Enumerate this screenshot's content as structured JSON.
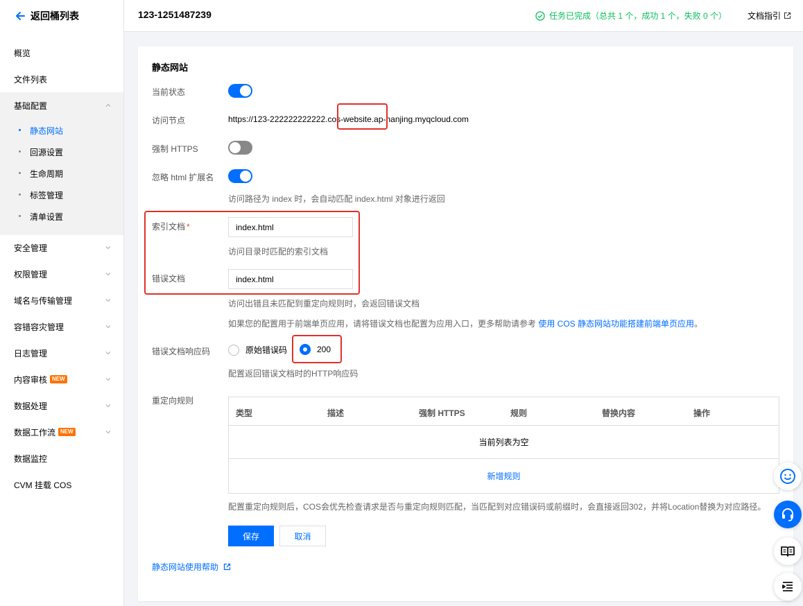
{
  "sidebar": {
    "back_label": "返回桶列表",
    "items": [
      {
        "label": "概览"
      },
      {
        "label": "文件列表"
      },
      {
        "label": "基础配置"
      },
      {
        "label": "安全管理"
      },
      {
        "label": "权限管理"
      },
      {
        "label": "域名与传输管理"
      },
      {
        "label": "容错容灾管理"
      },
      {
        "label": "日志管理"
      },
      {
        "label": "内容审核",
        "badge": "NEW"
      },
      {
        "label": "数据处理"
      },
      {
        "label": "数据工作流",
        "badge": "NEW"
      },
      {
        "label": "数据监控"
      },
      {
        "label": "CVM 挂载 COS"
      }
    ],
    "sub_items": [
      {
        "label": "静态网站",
        "active": true
      },
      {
        "label": "回源设置"
      },
      {
        "label": "生命周期"
      },
      {
        "label": "标签管理"
      },
      {
        "label": "清单设置"
      }
    ]
  },
  "header": {
    "bucket_name": "123-1251487239",
    "task_status": "任务已完成（总共 1 个，成功 1 个，失败 0 个）",
    "doc_guide": "文档指引"
  },
  "form": {
    "title": "静态网站",
    "status_label": "当前状态",
    "status_on": true,
    "endpoint_label": "访问节点",
    "endpoint_value": "https://123-222222222222.cos-website.ap-nanjing.myqcloud.com",
    "https_label": "强制 HTTPS",
    "https_on": false,
    "ignore_html_label": "忽略 html 扩展名",
    "ignore_html_on": true,
    "ignore_html_hint": "访问路径为 index 时，会自动匹配 index.html 对象进行返回",
    "index_label": "索引文档",
    "index_required": "*",
    "index_value": "index.html",
    "index_hint": "访问目录时匹配的索引文档",
    "error_label": "错误文档",
    "error_value": "index.html",
    "error_hint": "访问出错且未匹配到重定向规则时，会返回错误文档",
    "spa_hint_prefix": "如果您的配置用于前端单页应用，请将错误文档也配置为应用入口，更多帮助请参考 ",
    "spa_hint_link": "使用 COS 静态网站功能搭建前端单页应用",
    "spa_hint_suffix": "。",
    "error_code_label": "错误文档响应码",
    "error_code_options": [
      {
        "label": "原始错误码",
        "checked": false
      },
      {
        "label": "200",
        "checked": true
      }
    ],
    "error_code_hint": "配置返回错误文档时的HTTP响应码",
    "redirect_label": "重定向规则",
    "table_headers": [
      "类型",
      "描述",
      "强制 HTTPS",
      "规则",
      "替换内容",
      "操作"
    ],
    "table_empty": "当前列表为空",
    "table_add": "新增规则",
    "redirect_hint": "配置重定向规则后，COS会优先检查请求是否与重定向规则匹配，当匹配到对应错误码或前缀时，会直接返回302，并将Location替换为对应路径。",
    "save": "保存",
    "cancel": "取消",
    "help_link": "静态网站使用帮助"
  },
  "colors": {
    "primary": "#006eff",
    "success": "#0abf5b",
    "badge": "#ff7200",
    "highlight": "#e0302a"
  },
  "icons": [
    "arrow-left-icon",
    "chevron-down-icon",
    "chevron-up-icon",
    "check-circle-icon",
    "external-link-icon",
    "smile-icon",
    "headset-icon",
    "book-icon",
    "menu-icon"
  ]
}
